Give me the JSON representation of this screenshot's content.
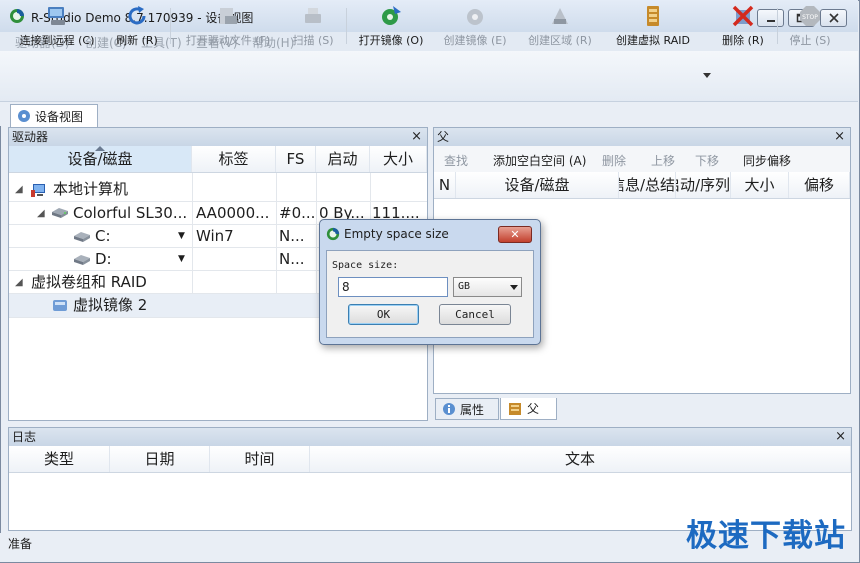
{
  "window": {
    "title": "R-Studio Demo 8.7.170939 - 设备视图"
  },
  "menu": [
    "驱动器(D)",
    "创建(C)",
    "工具(T)",
    "查看(V)",
    "帮助(H)"
  ],
  "toolbar": {
    "connect": "连接到远程 (C)",
    "refresh": "刷新 (R)",
    "open_drive_files": "打开驱动文件 (F)",
    "scan": "扫描 (S)",
    "open_image": "打开镜像 (O)",
    "create_image": "创建镜像 (E)",
    "create_region": "创建区域 (R)",
    "create_virtual_raid": "创建虚拟 RAID",
    "delete": "删除 (R)",
    "stop": "停止 (S)"
  },
  "main_tab": "设备视图",
  "drives_panel": {
    "title": "驱动器",
    "close": "×",
    "columns": [
      "设备/磁盘",
      "标签",
      "FS",
      "启动",
      "大小"
    ],
    "rows": [
      {
        "indent": 0,
        "name": "本地计算机",
        "label": "",
        "fs": "",
        "boot": "",
        "size": ""
      },
      {
        "indent": 1,
        "name": "Colorful SL30...",
        "label": "AA0000...",
        "fs": "#0...",
        "boot": "0 By...",
        "size": "111...."
      },
      {
        "indent": 2,
        "name": "C:",
        "label": "Win7",
        "fs": "N...",
        "boot": "",
        "size": ""
      },
      {
        "indent": 2,
        "name": "D:",
        "label": "",
        "fs": "N...",
        "boot": "",
        "size": ""
      },
      {
        "indent": 0,
        "name": "虚拟卷组和 RAID",
        "label": "",
        "fs": "",
        "boot": "",
        "size": ""
      },
      {
        "indent": 1,
        "name": "虚拟镜像 2",
        "label": "",
        "fs": "",
        "boot": "",
        "size": ""
      }
    ]
  },
  "parent_panel": {
    "title": "父",
    "close": "×",
    "actions": [
      "查找",
      "添加空白空间 (A)",
      "删除",
      "上移",
      "下移",
      "同步偏移"
    ],
    "columns": [
      "N",
      "设备/磁盘",
      "信息/总结",
      "启动/序列",
      "大小",
      "偏移"
    ],
    "tabs": [
      "属性",
      "父"
    ]
  },
  "log_panel": {
    "title": "日志",
    "close": "×",
    "columns": [
      "类型",
      "日期",
      "时间",
      "文本"
    ]
  },
  "dialog": {
    "title": "Empty space size",
    "close": "✕",
    "label": "Space size:",
    "value": "8",
    "unit": "GB",
    "ok": "OK",
    "cancel": "Cancel"
  },
  "status": "准备",
  "watermark": "极速下载站"
}
